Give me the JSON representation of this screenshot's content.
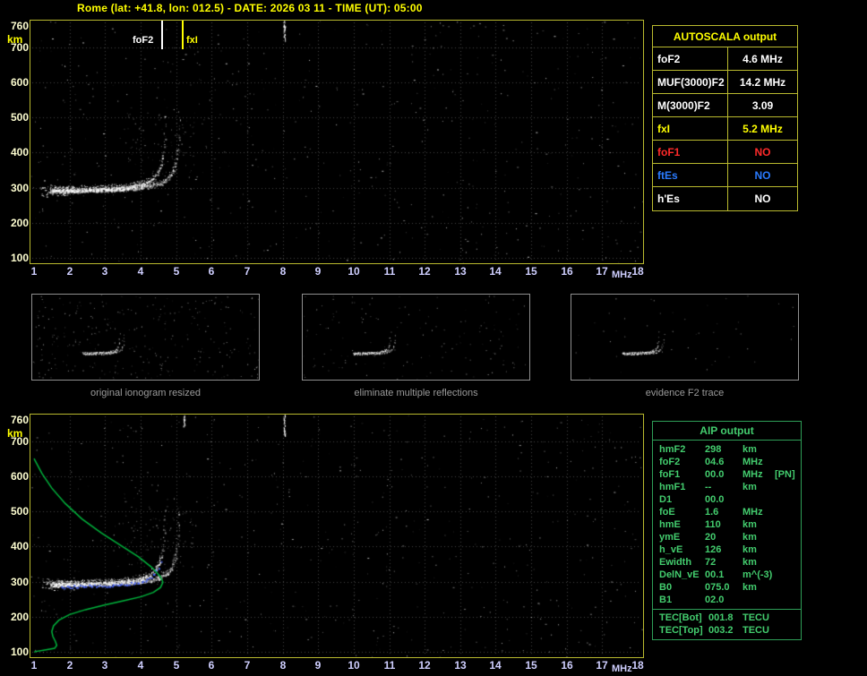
{
  "title": "Rome (lat: +41.8, lon: 012.5) - DATE: 2026 03 11 - TIME (UT): 05:00",
  "plot_axes": {
    "y_unit": "km",
    "x_unit": "MHz",
    "y_ticks": [
      "760",
      "700",
      "600",
      "500",
      "400",
      "300",
      "200",
      "100"
    ],
    "x_ticks": [
      "1",
      "2",
      "3",
      "4",
      "5",
      "6",
      "7",
      "8",
      "9",
      "10",
      "11",
      "12",
      "13",
      "14",
      "15",
      "16",
      "17",
      "18"
    ]
  },
  "main_plot": {
    "fof2_label": "foF2",
    "fxi_label": "fxI"
  },
  "autoscala_table": {
    "header": "AUTOSCALA output",
    "rows": [
      {
        "label": "foF2",
        "value": "4.6 MHz",
        "color": "white"
      },
      {
        "label": "MUF(3000)F2",
        "value": "14.2 MHz",
        "color": "white"
      },
      {
        "label": "M(3000)F2",
        "value": "3.09",
        "color": "white"
      },
      {
        "label": "fxI",
        "value": "5.2 MHz",
        "color": "yellow"
      },
      {
        "label": "foF1",
        "value": "NO",
        "color": "red"
      },
      {
        "label": "ftEs",
        "value": "NO",
        "color": "blue"
      },
      {
        "label": "h'Es",
        "value": "NO",
        "color": "white"
      }
    ]
  },
  "thumbnails": [
    {
      "caption": "original ionogram resized"
    },
    {
      "caption": "eliminate multiple reflections"
    },
    {
      "caption": "evidence F2 trace"
    }
  ],
  "aip_table": {
    "header": "AIP output",
    "rows": [
      {
        "label": "hmF2",
        "value": "298",
        "unit": "km",
        "extra": ""
      },
      {
        "label": "foF2",
        "value": "04.6",
        "unit": "MHz",
        "extra": ""
      },
      {
        "label": "foF1",
        "value": "00.0",
        "unit": "MHz",
        "extra": "[PN]"
      },
      {
        "label": "hmF1",
        "value": "--",
        "unit": "km",
        "extra": ""
      },
      {
        "label": "D1",
        "value": "00.0",
        "unit": "",
        "extra": ""
      },
      {
        "label": "foE",
        "value": "1.6",
        "unit": "MHz",
        "extra": ""
      },
      {
        "label": "hmE",
        "value": "110",
        "unit": "km",
        "extra": ""
      },
      {
        "label": "ymE",
        "value": "20",
        "unit": "km",
        "extra": ""
      },
      {
        "label": "h_vE",
        "value": "126",
        "unit": "km",
        "extra": ""
      },
      {
        "label": "Ewidth",
        "value": "72",
        "unit": "km",
        "extra": ""
      },
      {
        "label": "DelN_vE",
        "value": "00.1",
        "unit": "m^(-3)",
        "extra": ""
      },
      {
        "label": "B0",
        "value": "075.0",
        "unit": "km",
        "extra": ""
      },
      {
        "label": "B1",
        "value": "02.0",
        "unit": "",
        "extra": ""
      }
    ],
    "tec_rows": [
      {
        "label": "TEC[Bot]",
        "value": "001.8",
        "unit": "TECU"
      },
      {
        "label": "TEC[Top]",
        "value": "003.2",
        "unit": "TECU"
      }
    ]
  },
  "colors": {
    "accent_yellow": "#ffff00",
    "status_red": "#ff2a2a",
    "status_blue": "#2a7bff",
    "aip_green": "#43cd6e",
    "profile_green": "#00b33c"
  }
}
